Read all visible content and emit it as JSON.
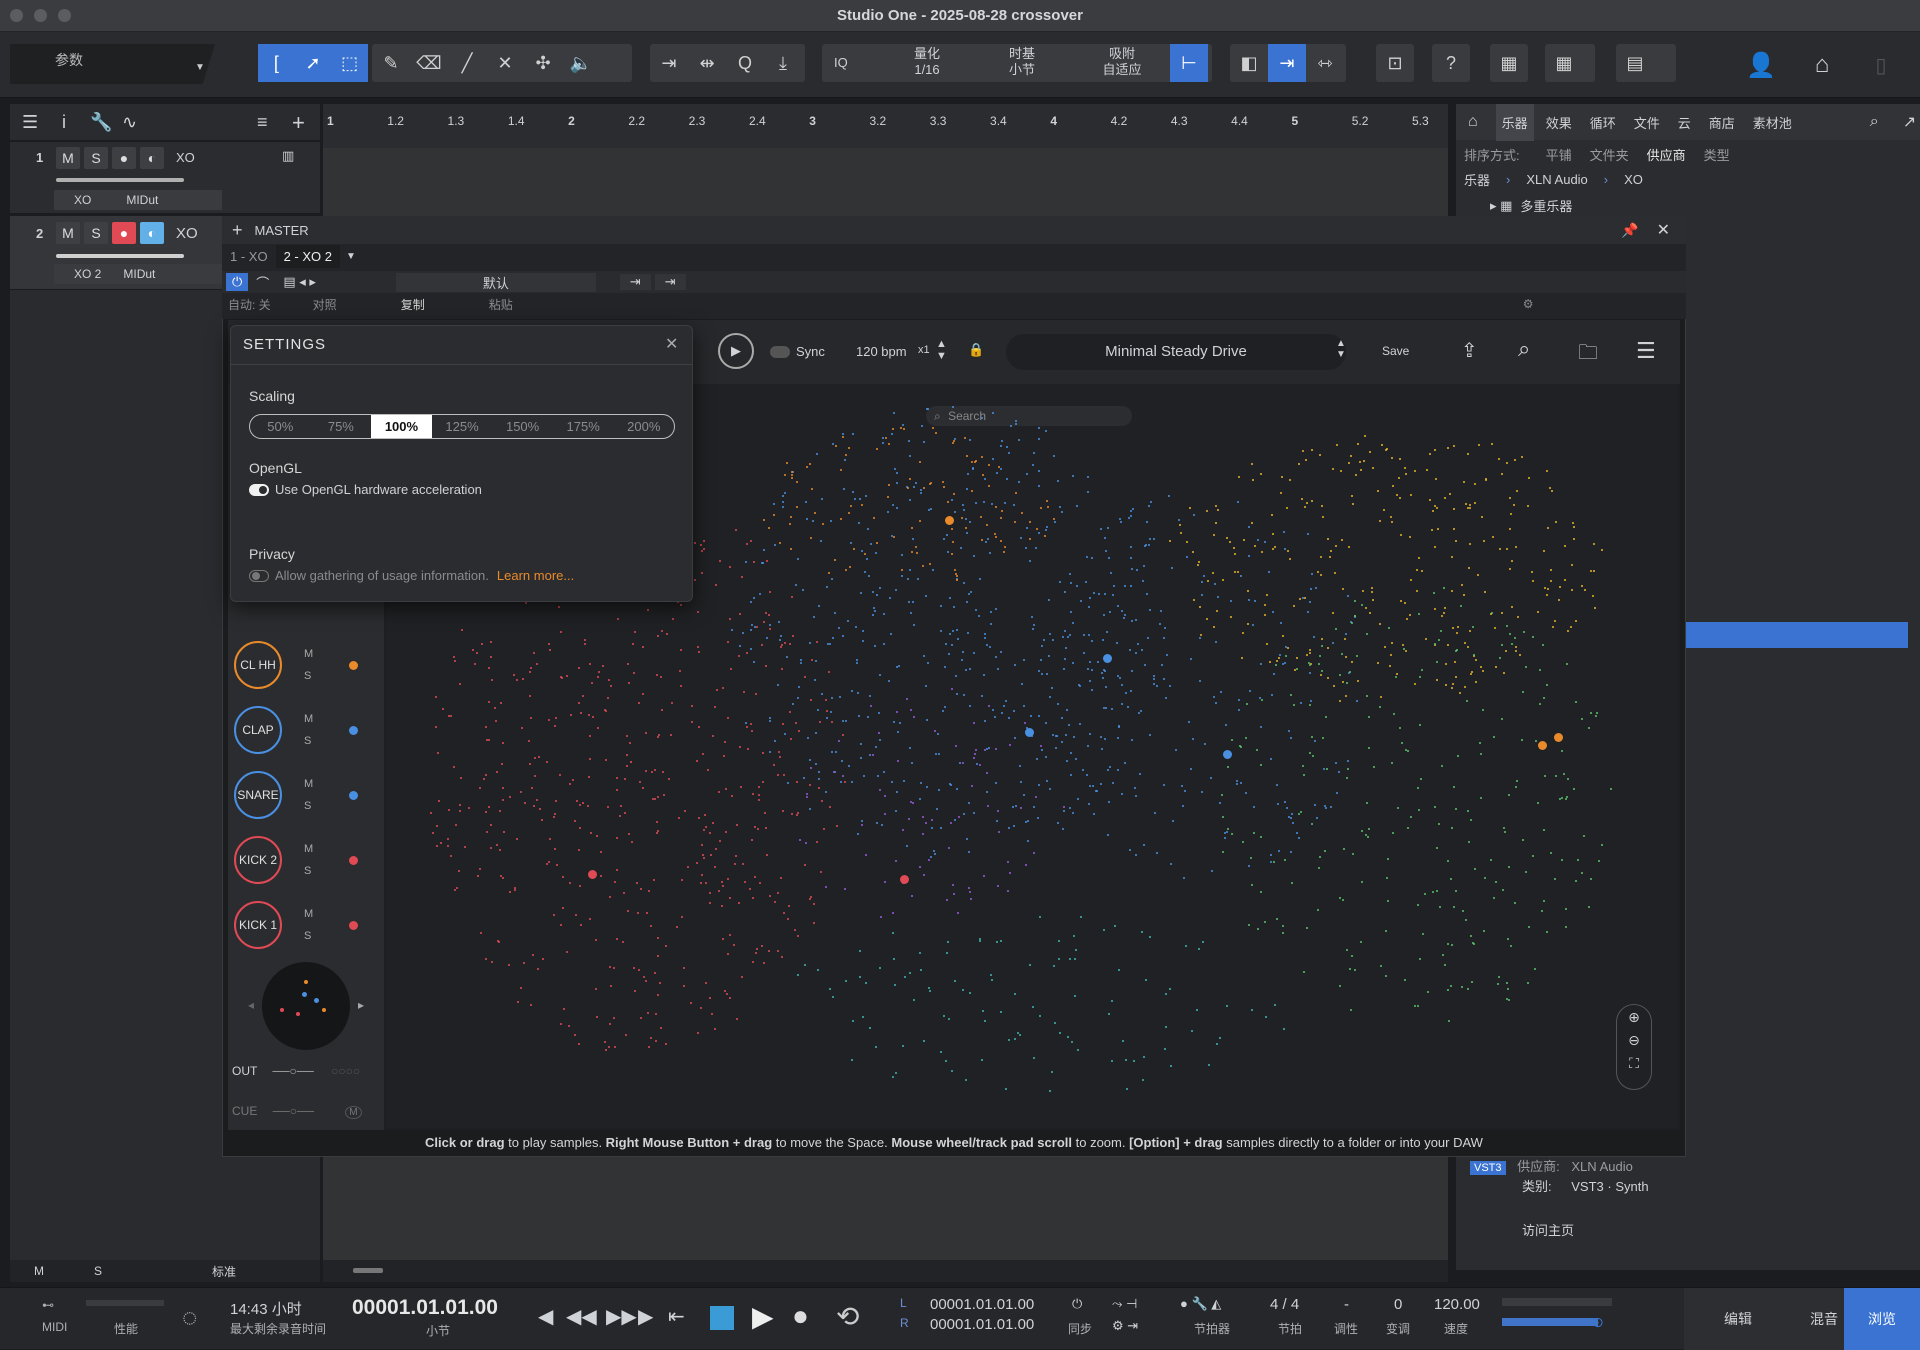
{
  "window": {
    "title": "Studio One - 2025-08-28 crossover"
  },
  "toolbar": {
    "param_label": "参数",
    "iq_label": "IQ",
    "quantize": {
      "label": "量化",
      "value": "1/16"
    },
    "timebase": {
      "label": "时基",
      "value": "小节"
    },
    "snap": {
      "label": "吸附",
      "value": "自适应"
    }
  },
  "tracks_panel": {
    "tracks": [
      {
        "num": "1",
        "m": "M",
        "s": "S",
        "name": "XO",
        "instrument": "XO",
        "midi": "MIDut"
      },
      {
        "num": "2",
        "m": "M",
        "s": "S",
        "name": "XO",
        "instrument": "XO 2",
        "midi": "MIDut"
      }
    ],
    "footer": {
      "m": "M",
      "s": "S",
      "mode": "标准"
    }
  },
  "ruler": {
    "ticks": [
      "1",
      "1.2",
      "1.3",
      "1.4",
      "2",
      "2.2",
      "2.3",
      "2.4",
      "3",
      "3.2",
      "3.3",
      "3.4",
      "4",
      "4.2",
      "4.3",
      "4.4",
      "5",
      "5.2",
      "5.3"
    ]
  },
  "browser": {
    "tabs": [
      "乐器",
      "效果",
      "循环",
      "文件",
      "云",
      "商店",
      "素材池"
    ],
    "sort_label": "排序方式:",
    "sort_options": [
      "平铺",
      "文件夹",
      "供应商",
      "类型"
    ],
    "path": [
      "乐器",
      "XLN Audio",
      "XO"
    ],
    "folder": "多重乐器",
    "info": {
      "vendor_label": "供应商:",
      "vendor": "XLN Audio",
      "type_label": "类别:",
      "type": "VST3 · Synth",
      "badge": "VST3",
      "homepage": "访问主页"
    }
  },
  "plugin_window": {
    "header_title": "MASTER",
    "tabs": [
      "1 - XO",
      "2 - XO 2"
    ],
    "preset_default": "默认",
    "auto_label": "自动: 关",
    "compare_label": "对照",
    "copy_label": "复制",
    "paste_label": "粘贴"
  },
  "xo": {
    "sync_label": "Sync",
    "bpm": "120 bpm",
    "multiplier": "x1",
    "preset_name": "Minimal Steady Drive",
    "save_label": "Save",
    "search_placeholder": "Search",
    "pads": [
      {
        "name": "CL HH",
        "color": "#e98a2b"
      },
      {
        "name": "CLAP",
        "color": "#4a90e2"
      },
      {
        "name": "SNARE",
        "color": "#4a90e2"
      },
      {
        "name": "KICK 2",
        "color": "#e04a55"
      },
      {
        "name": "KICK 1",
        "color": "#e04a55"
      }
    ],
    "pad_m": "M",
    "pad_s": "S",
    "out_label": "OUT",
    "cue_label": "CUE",
    "cue_m": "M",
    "hint": {
      "p1": "Click or drag",
      "p2": " to play samples. ",
      "p3": "Right Mouse Button + drag",
      "p4": " to move the Space. ",
      "p5": "Mouse wheel/track pad scroll",
      "p6": " to zoom. ",
      "p7": "[Option] + drag",
      "p8": " samples directly to a folder or into your DAW"
    }
  },
  "settings": {
    "title": "SETTINGS",
    "scaling_label": "Scaling",
    "scaling_options": [
      "50%",
      "75%",
      "100%",
      "125%",
      "150%",
      "175%",
      "200%"
    ],
    "scaling_selected": "100%",
    "opengl_label": "OpenGL",
    "opengl_option": "Use OpenGL hardware acceleration",
    "opengl_on": true,
    "privacy_label": "Privacy",
    "privacy_option": "Allow gathering of usage information.",
    "privacy_on": false,
    "learn_more": "Learn more..."
  },
  "transport": {
    "midi_label": "MIDI",
    "perf_label": "性能",
    "rec_time": "14:43 小时",
    "rec_time_label": "最大剩余录音时间",
    "position": "00001.01.01.00",
    "position_unit": "小节",
    "loop_l": "00001.01.01.00",
    "loop_r": "00001.01.01.00",
    "l": "L",
    "r": "R",
    "sync_label": "同步",
    "metronome_label": "节拍器",
    "signature": "4 / 4",
    "signature_label": "节拍",
    "key": "-",
    "key_label": "调性",
    "transpose": "0",
    "transpose_label": "变调",
    "tempo": "120.00",
    "tempo_label": "速度",
    "edit": "编辑",
    "mix": "混音",
    "browse": "浏览"
  },
  "colors": {
    "accent": "#3a73d1",
    "red": "#e04a55",
    "orange": "#e98a2b",
    "blue": "#4a90e2",
    "link": "#e98a2b"
  }
}
